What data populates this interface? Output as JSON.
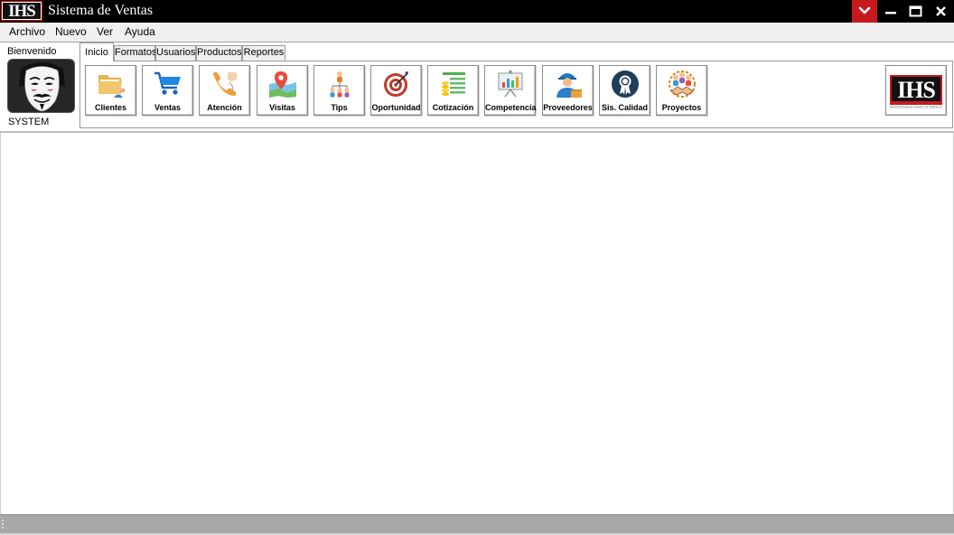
{
  "window": {
    "logo_text": "IHS",
    "title": "Sistema de Ventas",
    "controls": {
      "dropdown_icon": "chevron-down-icon",
      "minimize_icon": "minimize-icon",
      "maximize_icon": "maximize-icon",
      "close_icon": "close-icon",
      "accent_color": "#c8191e"
    }
  },
  "menu": {
    "items": [
      "Archivo",
      "Nuevo",
      "Ver",
      "Ayuda"
    ]
  },
  "user_panel": {
    "welcome": "Bienvenido",
    "avatar_icon": "mask-avatar-icon",
    "username": "SYSTEM"
  },
  "tabs": [
    {
      "label": "Inicio",
      "active": true
    },
    {
      "label": "Formatos",
      "active": false
    },
    {
      "label": "Usuarios",
      "active": false
    },
    {
      "label": "Productos",
      "active": false
    },
    {
      "label": "Reportes",
      "active": false
    }
  ],
  "toolbar": {
    "buttons": [
      {
        "label": "Clientes",
        "icon": "folder-clients-icon"
      },
      {
        "label": "Ventas",
        "icon": "shopping-cart-icon"
      },
      {
        "label": "Atención",
        "icon": "phone-support-icon"
      },
      {
        "label": "Visitas",
        "icon": "map-pin-icon"
      },
      {
        "label": "Tips",
        "icon": "team-tips-icon"
      },
      {
        "label": "Oportunidad",
        "icon": "target-icon"
      },
      {
        "label": "Cotización",
        "icon": "quote-list-icon"
      },
      {
        "label": "Competencia",
        "icon": "presentation-board-icon"
      },
      {
        "label": "Proveedores",
        "icon": "delivery-person-icon"
      },
      {
        "label": "Sis. Calidad",
        "icon": "quality-badge-icon"
      },
      {
        "label": "Proyectos",
        "icon": "handshake-team-icon"
      }
    ],
    "company_logo": {
      "text": "IHS",
      "subtitle": "INTERNATIONAL HOMES OF SERVICES"
    }
  }
}
